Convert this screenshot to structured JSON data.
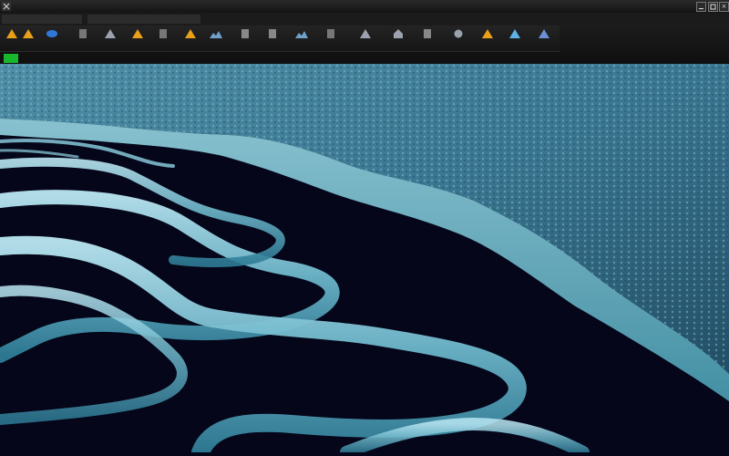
{
  "menu": {
    "items": [
      "",
      "",
      "",
      "",
      "",
      "",
      "",
      "",
      "",
      ""
    ]
  },
  "window": {
    "close_label": "×"
  },
  "toolbar": {
    "tools": [
      {
        "label": "",
        "icon": "orange-triangle-icon",
        "color": "#e8a019"
      },
      {
        "label": "",
        "icon": "orange-triangle-icon",
        "color": "#e8a019"
      },
      {
        "label": "",
        "icon": "blue-oval-icon",
        "color": "#2f77d8"
      },
      {
        "label": "",
        "icon": "gray-square-icon",
        "color": "#777777"
      },
      {
        "label": "",
        "icon": "gray-mountain-icon",
        "color": "#9aa3ad"
      },
      {
        "label": "",
        "icon": "orange-triangle-icon",
        "color": "#e8a019"
      },
      {
        "label": "",
        "icon": "gray-panel-icon",
        "color": "#777777"
      },
      {
        "label": "",
        "icon": "orange-triangle-icon",
        "color": "#e8a019"
      },
      {
        "label": "",
        "icon": "terrain-icon",
        "color": "#6fa0c8"
      },
      {
        "label": "",
        "icon": "grid-icon",
        "color": "#888888"
      },
      {
        "label": "",
        "icon": "grid-icon",
        "color": "#888888"
      },
      {
        "label": "",
        "icon": "terrain-icon",
        "color": "#6fa0c8"
      },
      {
        "label": "",
        "icon": "gray-panel-icon",
        "color": "#777777"
      },
      {
        "label": "",
        "icon": "gray-mountain-icon",
        "color": "#9aa3ad"
      },
      {
        "label": "",
        "icon": "house-icon",
        "color": "#9aa3ad"
      },
      {
        "label": "",
        "icon": "grid-icon",
        "color": "#888888"
      },
      {
        "label": "",
        "icon": "circle-icon",
        "color": "#9aa3ad"
      },
      {
        "label": "",
        "icon": "orange-triangle-icon",
        "color": "#e8a019"
      },
      {
        "label": "",
        "icon": "blue-triangle-icon",
        "color": "#5fb2e8"
      },
      {
        "label": "",
        "icon": "blue-mountain-icon",
        "color": "#6c8fd8"
      }
    ]
  },
  "layers": {
    "tabs": [
      "",
      "",
      "",
      "",
      "",
      "",
      "",
      "",
      "",
      "",
      "",
      "",
      "",
      "",
      "",
      "",
      ""
    ]
  },
  "scene": {
    "water_color": "#05061a",
    "shore_color": "#5fb8c9",
    "terrain_color": "#3f7f96",
    "ripple_color": "#8fd3e3"
  }
}
